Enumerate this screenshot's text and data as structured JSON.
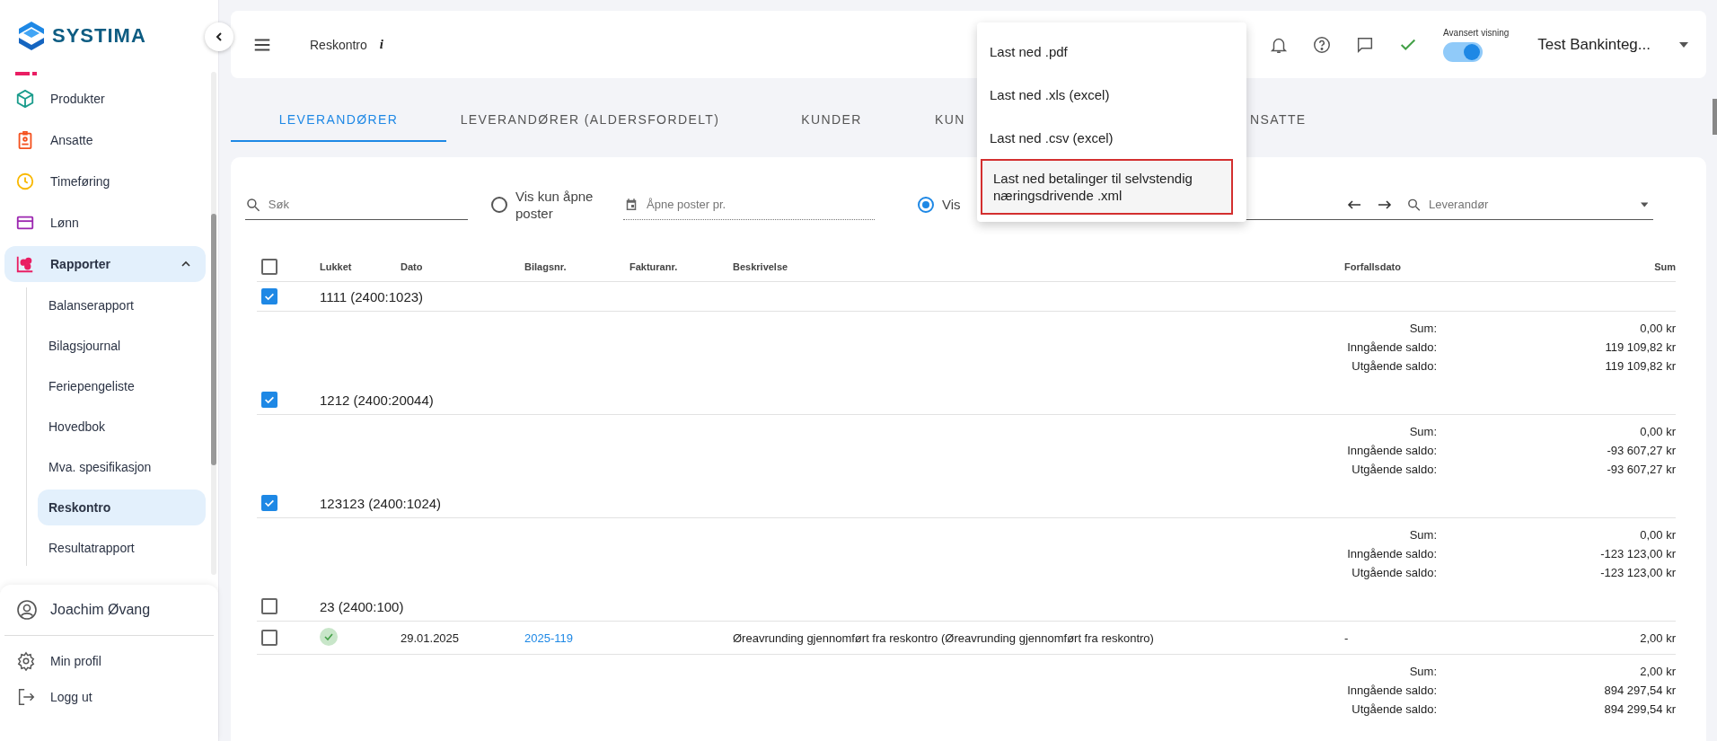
{
  "sidebar": {
    "logo": "SYSTIMA",
    "items": [
      {
        "label": "Produkter",
        "expanded": false
      },
      {
        "label": "Ansatte",
        "expanded": false
      },
      {
        "label": "Timeføring",
        "expanded": false
      },
      {
        "label": "Lønn",
        "expanded": false
      },
      {
        "label": "Rapporter",
        "expanded": true,
        "children": [
          {
            "label": "Balanserapport",
            "selected": false
          },
          {
            "label": "Bilagsjournal",
            "selected": false
          },
          {
            "label": "Feriepengeliste",
            "selected": false
          },
          {
            "label": "Hovedbok",
            "selected": false
          },
          {
            "label": "Mva. spesifikasjon",
            "selected": false
          },
          {
            "label": "Reskontro",
            "selected": true
          },
          {
            "label": "Resultatrapport",
            "selected": false
          }
        ]
      }
    ],
    "user": "Joachim Øvang",
    "footer_items": [
      {
        "label": "Min profil"
      },
      {
        "label": "Logg ut"
      }
    ]
  },
  "header": {
    "title": "Reskontro",
    "info": "i",
    "toggle": {
      "label": "Avansert visning",
      "on": true
    },
    "company": "Test Bankinteg..."
  },
  "menu": [
    {
      "label": "Last ned .pdf",
      "highlighted": false
    },
    {
      "label": "Last ned .xls (excel)",
      "highlighted": false
    },
    {
      "label": "Last ned .csv (excel)",
      "highlighted": false
    },
    {
      "label": "Last ned betalinger til selvstendig næringsdrivende .xml",
      "highlighted": true
    }
  ],
  "tabs": [
    {
      "label": "LEVERANDØRER",
      "selected": true
    },
    {
      "label": "LEVERANDØRER (ALDERSFORDELT)",
      "selected": false
    },
    {
      "label": "KUNDER",
      "selected": false
    },
    {
      "label": "KUN",
      "selected": false
    },
    {
      "label": "NSATTE",
      "selected": false
    }
  ],
  "filters": {
    "search": {
      "placeholder": "Søk"
    },
    "open_only": {
      "label": "Vis kun åpne poster",
      "selected": false
    },
    "open_date": {
      "placeholder": "Åpne poster pr."
    },
    "period": {
      "label": "Vis",
      "selected": true
    },
    "supplier": {
      "placeholder": "Leverandør"
    }
  },
  "table": {
    "columns": [
      "Lukket",
      "Dato",
      "Bilagsnr.",
      "Fakturanr.",
      "Beskrivelse",
      "Forfallsdato",
      "Sum"
    ],
    "all_checked": false,
    "groups": [
      {
        "title": "1111 (2400:1023)",
        "checked": true,
        "summary": [
          {
            "label": "Sum:",
            "value": "0,00 kr"
          },
          {
            "label": "Inngående saldo:",
            "value": "119 109,82 kr"
          },
          {
            "label": "Utgående saldo:",
            "value": "119 109,82 kr"
          }
        ]
      },
      {
        "title": "1212 (2400:20044)",
        "checked": true,
        "summary": [
          {
            "label": "Sum:",
            "value": "0,00 kr"
          },
          {
            "label": "Inngående saldo:",
            "value": "-93 607,27 kr"
          },
          {
            "label": "Utgående saldo:",
            "value": "-93 607,27 kr"
          }
        ]
      },
      {
        "title": "123123 (2400:1024)",
        "checked": true,
        "summary": [
          {
            "label": "Sum:",
            "value": "0,00 kr"
          },
          {
            "label": "Inngående saldo:",
            "value": "-123 123,00 kr"
          },
          {
            "label": "Utgående saldo:",
            "value": "-123 123,00 kr"
          }
        ]
      },
      {
        "title": "23 (2400:100)",
        "checked": false,
        "rows": [
          {
            "checked": false,
            "closed": true,
            "date": "29.01.2025",
            "voucher": "2025-119",
            "description": "Øreavrunding gjennomført fra reskontro (Øreavrunding gjennomført fra reskontro)",
            "due": "-",
            "sum": "2,00 kr"
          }
        ],
        "summary": [
          {
            "label": "Sum:",
            "value": "2,00 kr"
          },
          {
            "label": "Inngående saldo:",
            "value": "894 297,54 kr"
          },
          {
            "label": "Utgående saldo:",
            "value": "894 299,54 kr"
          }
        ]
      }
    ]
  }
}
